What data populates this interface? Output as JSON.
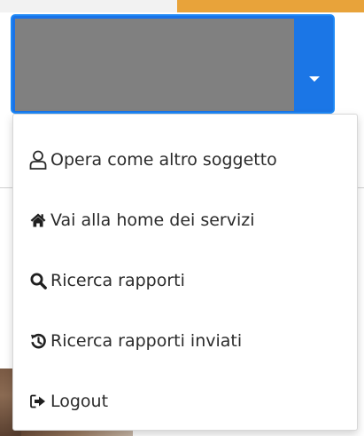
{
  "split_button": {
    "main_color": "#808080",
    "accent_color": "#1a73e8",
    "caret_icon": "caret-down-icon"
  },
  "menu": {
    "items": [
      {
        "label": "Opera come altro soggetto",
        "icon": "user-outline-icon"
      },
      {
        "label": "Vai alla home dei servizi",
        "icon": "home-icon"
      },
      {
        "label": "Ricerca rapporti",
        "icon": "search-icon"
      },
      {
        "label": "Ricerca rapporti inviati",
        "icon": "history-icon"
      },
      {
        "label": "Logout",
        "icon": "logout-icon"
      }
    ]
  }
}
